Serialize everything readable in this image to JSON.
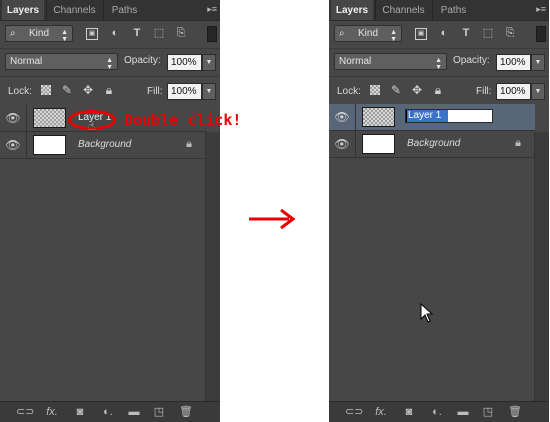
{
  "tabs": [
    {
      "label": "Layers",
      "active": true
    },
    {
      "label": "Channels",
      "active": false
    },
    {
      "label": "Paths",
      "active": false
    }
  ],
  "filter": {
    "kind_label": "Kind"
  },
  "blend_mode": "Normal",
  "opacity": {
    "label": "Opacity:",
    "value": "100%"
  },
  "lock_label": "Lock:",
  "fill": {
    "label": "Fill:",
    "value": "100%"
  },
  "layers": [
    {
      "name": "Layer 1",
      "thumbnail": "transparent"
    },
    {
      "name": "Background",
      "thumbnail": "white",
      "locked": true
    }
  ],
  "annotation": {
    "text": "Double click!",
    "color": "#ea0000"
  },
  "colors": {
    "panel": "#474747",
    "selection": "#596678",
    "highlight": "#3b73c9",
    "arrow": "#ea0000"
  },
  "icons": {
    "visibility": "eye-icon",
    "filters": [
      "image-filter-icon",
      "adjustment-filter-icon",
      "type-filter-icon",
      "shape-filter-icon",
      "smart-object-filter-icon"
    ],
    "locks": [
      "lock-transparent-pixels-icon",
      "lock-image-pixels-icon",
      "lock-position-icon",
      "lock-all-icon"
    ],
    "bottom": [
      "link-layers-icon",
      "fx-icon",
      "add-mask-icon",
      "new-fill-adjustment-icon",
      "new-group-icon",
      "new-layer-icon",
      "delete-layer-icon"
    ]
  }
}
